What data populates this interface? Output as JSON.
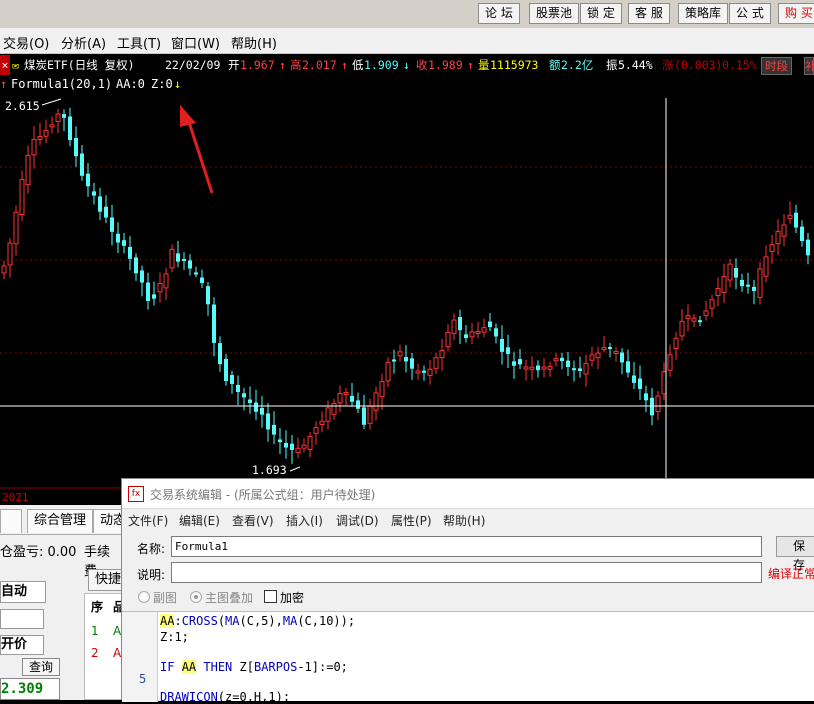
{
  "topbar": {
    "buttons": [
      "论 坛",
      "股票池",
      "锁 定",
      "客 服",
      "策略库",
      "公 式",
      "购 买"
    ]
  },
  "menubar": {
    "items": [
      "交易(O)",
      "分析(A)",
      "工具(T)",
      "窗口(W)",
      "帮助(H)"
    ]
  },
  "infobar": {
    "name": "煤炭ETF(日线 复权)",
    "date": "22/02/09",
    "open_label": "开",
    "open": "1.967",
    "high_label": "高",
    "high": "2.017",
    "low_label": "低",
    "low": "1.909",
    "close_label": "收",
    "close": "1.989",
    "volume_label": "量",
    "volume": "1115973",
    "amount_label": "额",
    "amount": "2.2亿",
    "amplitude_label": "振",
    "amplitude": "5.44%",
    "change_label": "涨",
    "change": "(0.003)",
    "change_pct": "0.15%",
    "button": "时段"
  },
  "formula_bar": {
    "name": "Formula1(20,1)",
    "aa": "AA:0",
    "z": "Z:0"
  },
  "chart_data": {
    "type": "candlestick",
    "max_label": "2.615",
    "min_label": "1.693",
    "year_label": "2021",
    "colors": {
      "up": "#ff3232",
      "down": "#54fcfc",
      "grid": "#8c0000",
      "crosshair": "#ffffff"
    }
  },
  "bottom_left": {
    "tabs": [
      "综合管理",
      "动态"
    ],
    "pnl": "仓盈亏: 0.00",
    "fee": "手续费",
    "mode": "自动",
    "price_label": "开价",
    "query": "查询",
    "quick": "快捷",
    "table_header": [
      "序",
      "品"
    ],
    "rows": [
      "1",
      "2"
    ],
    "price": "2.309"
  },
  "dialog": {
    "title": "交易系统编辑 - (所属公式组：用户待处理)",
    "menu": [
      "文件(F)",
      "编辑(E)",
      "查看(V)",
      "插入(I)",
      "调试(D)",
      "属性(P)",
      "帮助(H)"
    ],
    "name_label": "名称:",
    "name_value": "Formula1",
    "desc_label": "说明:",
    "desc_value": "",
    "save_button": "保存",
    "compile_status": "编译正常",
    "option_sub": "副图",
    "option_main": "主图叠加",
    "option_encrypt": "加密",
    "line_number": "5",
    "code": {
      "line1": "AA:CROSS(MA(C,5),MA(C,10));",
      "line2": "Z:1;",
      "line4": "IF AA THEN Z[BARPOS-1]:=0;",
      "line6": "DRAWICON(z=0,H,1);"
    }
  }
}
